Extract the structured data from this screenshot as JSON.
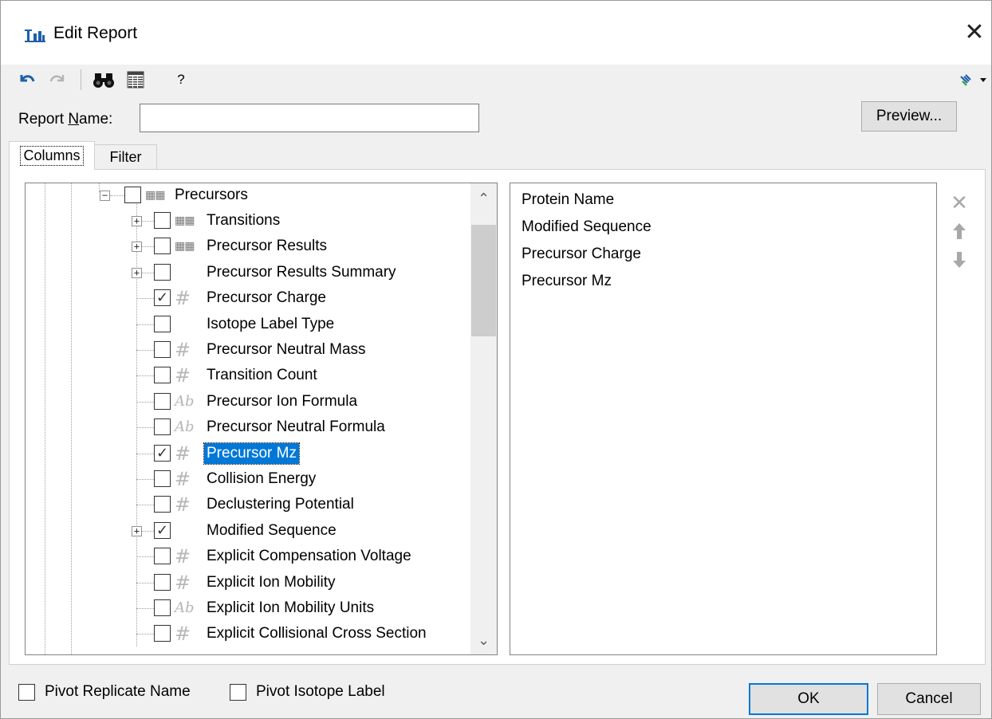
{
  "window": {
    "title": "Edit Report"
  },
  "toolbar": {
    "undo_icon": "undo-icon",
    "redo_icon": "redo-icon",
    "find_icon": "binoculars-icon",
    "columns_icon": "column-grid-icon",
    "help_label": "?",
    "menu_icon": "dropdown-menu-icon"
  },
  "report_name": {
    "label": "Report Name:",
    "value": ""
  },
  "preview_label": "Preview...",
  "tabs": [
    {
      "label": "Columns",
      "active": true
    },
    {
      "label": "Filter",
      "active": false
    }
  ],
  "tree": {
    "root": {
      "label": "Precursors",
      "expanded": true,
      "checked": false,
      "icon": "table-icon"
    },
    "children": [
      {
        "label": "Transitions",
        "expander": "+",
        "checked": false,
        "icon": "table-icon"
      },
      {
        "label": "Precursor Results",
        "expander": "+",
        "checked": false,
        "icon": "table-icon"
      },
      {
        "label": "Precursor Results Summary",
        "expander": "+",
        "checked": false,
        "icon": ""
      },
      {
        "label": "Precursor Charge",
        "expander": "",
        "checked": true,
        "icon": "hash-icon"
      },
      {
        "label": "Isotope Label Type",
        "expander": "",
        "checked": false,
        "icon": ""
      },
      {
        "label": "Precursor Neutral Mass",
        "expander": "",
        "checked": false,
        "icon": "hash-icon"
      },
      {
        "label": "Transition Count",
        "expander": "",
        "checked": false,
        "icon": "hash-icon"
      },
      {
        "label": "Precursor Ion Formula",
        "expander": "",
        "checked": false,
        "icon": "text-icon"
      },
      {
        "label": "Precursor Neutral Formula",
        "expander": "",
        "checked": false,
        "icon": "text-icon"
      },
      {
        "label": "Precursor Mz",
        "expander": "",
        "checked": true,
        "icon": "hash-icon",
        "selected": true
      },
      {
        "label": "Collision Energy",
        "expander": "",
        "checked": false,
        "icon": "hash-icon"
      },
      {
        "label": "Declustering Potential",
        "expander": "",
        "checked": false,
        "icon": "hash-icon"
      },
      {
        "label": "Modified Sequence",
        "expander": "+",
        "checked": true,
        "icon": ""
      },
      {
        "label": "Explicit Compensation Voltage",
        "expander": "",
        "checked": false,
        "icon": "hash-icon"
      },
      {
        "label": "Explicit Ion Mobility",
        "expander": "",
        "checked": false,
        "icon": "hash-icon"
      },
      {
        "label": "Explicit Ion Mobility Units",
        "expander": "",
        "checked": false,
        "icon": "text-icon"
      },
      {
        "label": "Explicit Collisional Cross Section",
        "expander": "",
        "checked": false,
        "icon": "hash-icon"
      }
    ]
  },
  "selected_columns": [
    "Protein Name",
    "Modified Sequence",
    "Precursor Charge",
    "Precursor Mz"
  ],
  "side_buttons": {
    "remove_icon": "remove-x-icon",
    "up_icon": "move-up-arrow-icon",
    "down_icon": "move-down-arrow-icon"
  },
  "pivot": {
    "replicate_label": "Pivot Replicate Name",
    "replicate_checked": false,
    "isotope_label": "Pivot Isotope Label",
    "isotope_checked": false
  },
  "buttons": {
    "ok": "OK",
    "cancel": "Cancel"
  },
  "colors": {
    "selection": "#0078d7",
    "dialog_bg": "#f0f0f0",
    "accent_blue": "#1f5fa8"
  }
}
